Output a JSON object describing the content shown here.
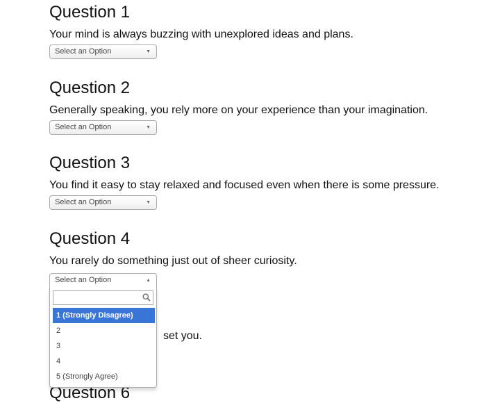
{
  "questions": [
    {
      "title": "Question 1",
      "text": "Your mind is always buzzing with unexplored ideas and plans.",
      "select_value": "Select an Option"
    },
    {
      "title": "Question 2",
      "text": "Generally speaking, you rely more on your experience than your imagination.",
      "select_value": "Select an Option"
    },
    {
      "title": "Question 3",
      "text": "You find it easy to stay relaxed and focused even when there is some pressure.",
      "select_value": "Select an Option"
    },
    {
      "title": "Question 4",
      "text": "You rarely do something just out of sheer curiosity.",
      "select_value": "Select an Option"
    }
  ],
  "dropdown": {
    "search_placeholder": "",
    "options": [
      "1 (Strongly Disagree)",
      "2",
      "3",
      "4",
      "5 (Strongly Agree)"
    ],
    "highlighted_index": 0
  },
  "partially_hidden": {
    "q5_text_fragment": "set you.",
    "q6_title": "Question 6"
  },
  "icons": {
    "select_closed": "triangle-down",
    "select_open": "triangle-up",
    "search": "magnifier"
  },
  "colors": {
    "highlight": "#3875d7",
    "border": "#aaaaaa"
  }
}
